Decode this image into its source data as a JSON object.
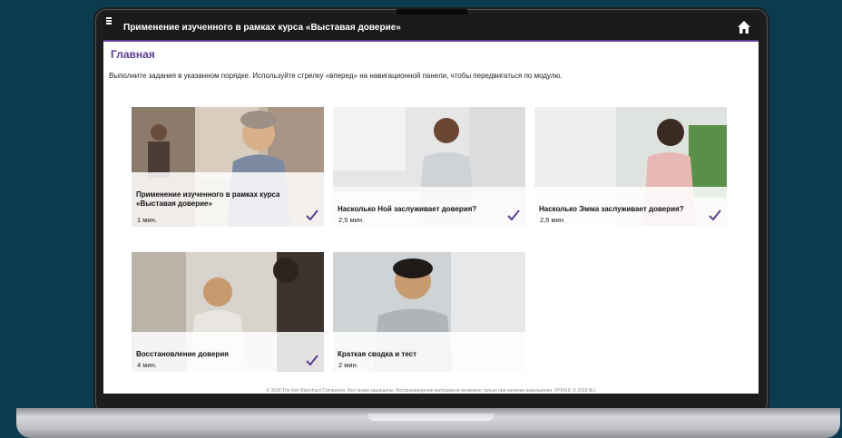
{
  "header": {
    "title": "Применение изученного в рамках курса «Выставая доверие»",
    "home_icon": "home-icon",
    "menu_icon": "menu-icon"
  },
  "page": {
    "title": "Главная",
    "instructions": "Выполните задания в указанном порядке. Используйте стрелку «вперед» на навигационной панели, чтобы передвигаться по модулю."
  },
  "cards": [
    {
      "title": "Применение изученного в рамках курса «Выставая доверие»",
      "duration": "1 мин.",
      "completed": true
    },
    {
      "title": "Насколько Ной заслуживает доверия?",
      "duration": "2,5 мин.",
      "completed": true
    },
    {
      "title": "Насколько Эмма заслуживает доверия?",
      "duration": "2,5 мин.",
      "completed": true
    },
    {
      "title": "Восстановление доверия",
      "duration": "4 мин.",
      "completed": true
    },
    {
      "title": "Краткая сводка и тест",
      "duration": "2 мин.",
      "completed": false
    }
  ],
  "footer": {
    "text": "© 2018 The Ken Blanchard Companies. Все права защищены. Воспроизведение материалов возможно только при наличии разрешения. VP0418. © 2018 BLI"
  },
  "colors": {
    "accent": "#5c3d8f",
    "check": "#5c3d8f",
    "background": "#0c3b50"
  }
}
